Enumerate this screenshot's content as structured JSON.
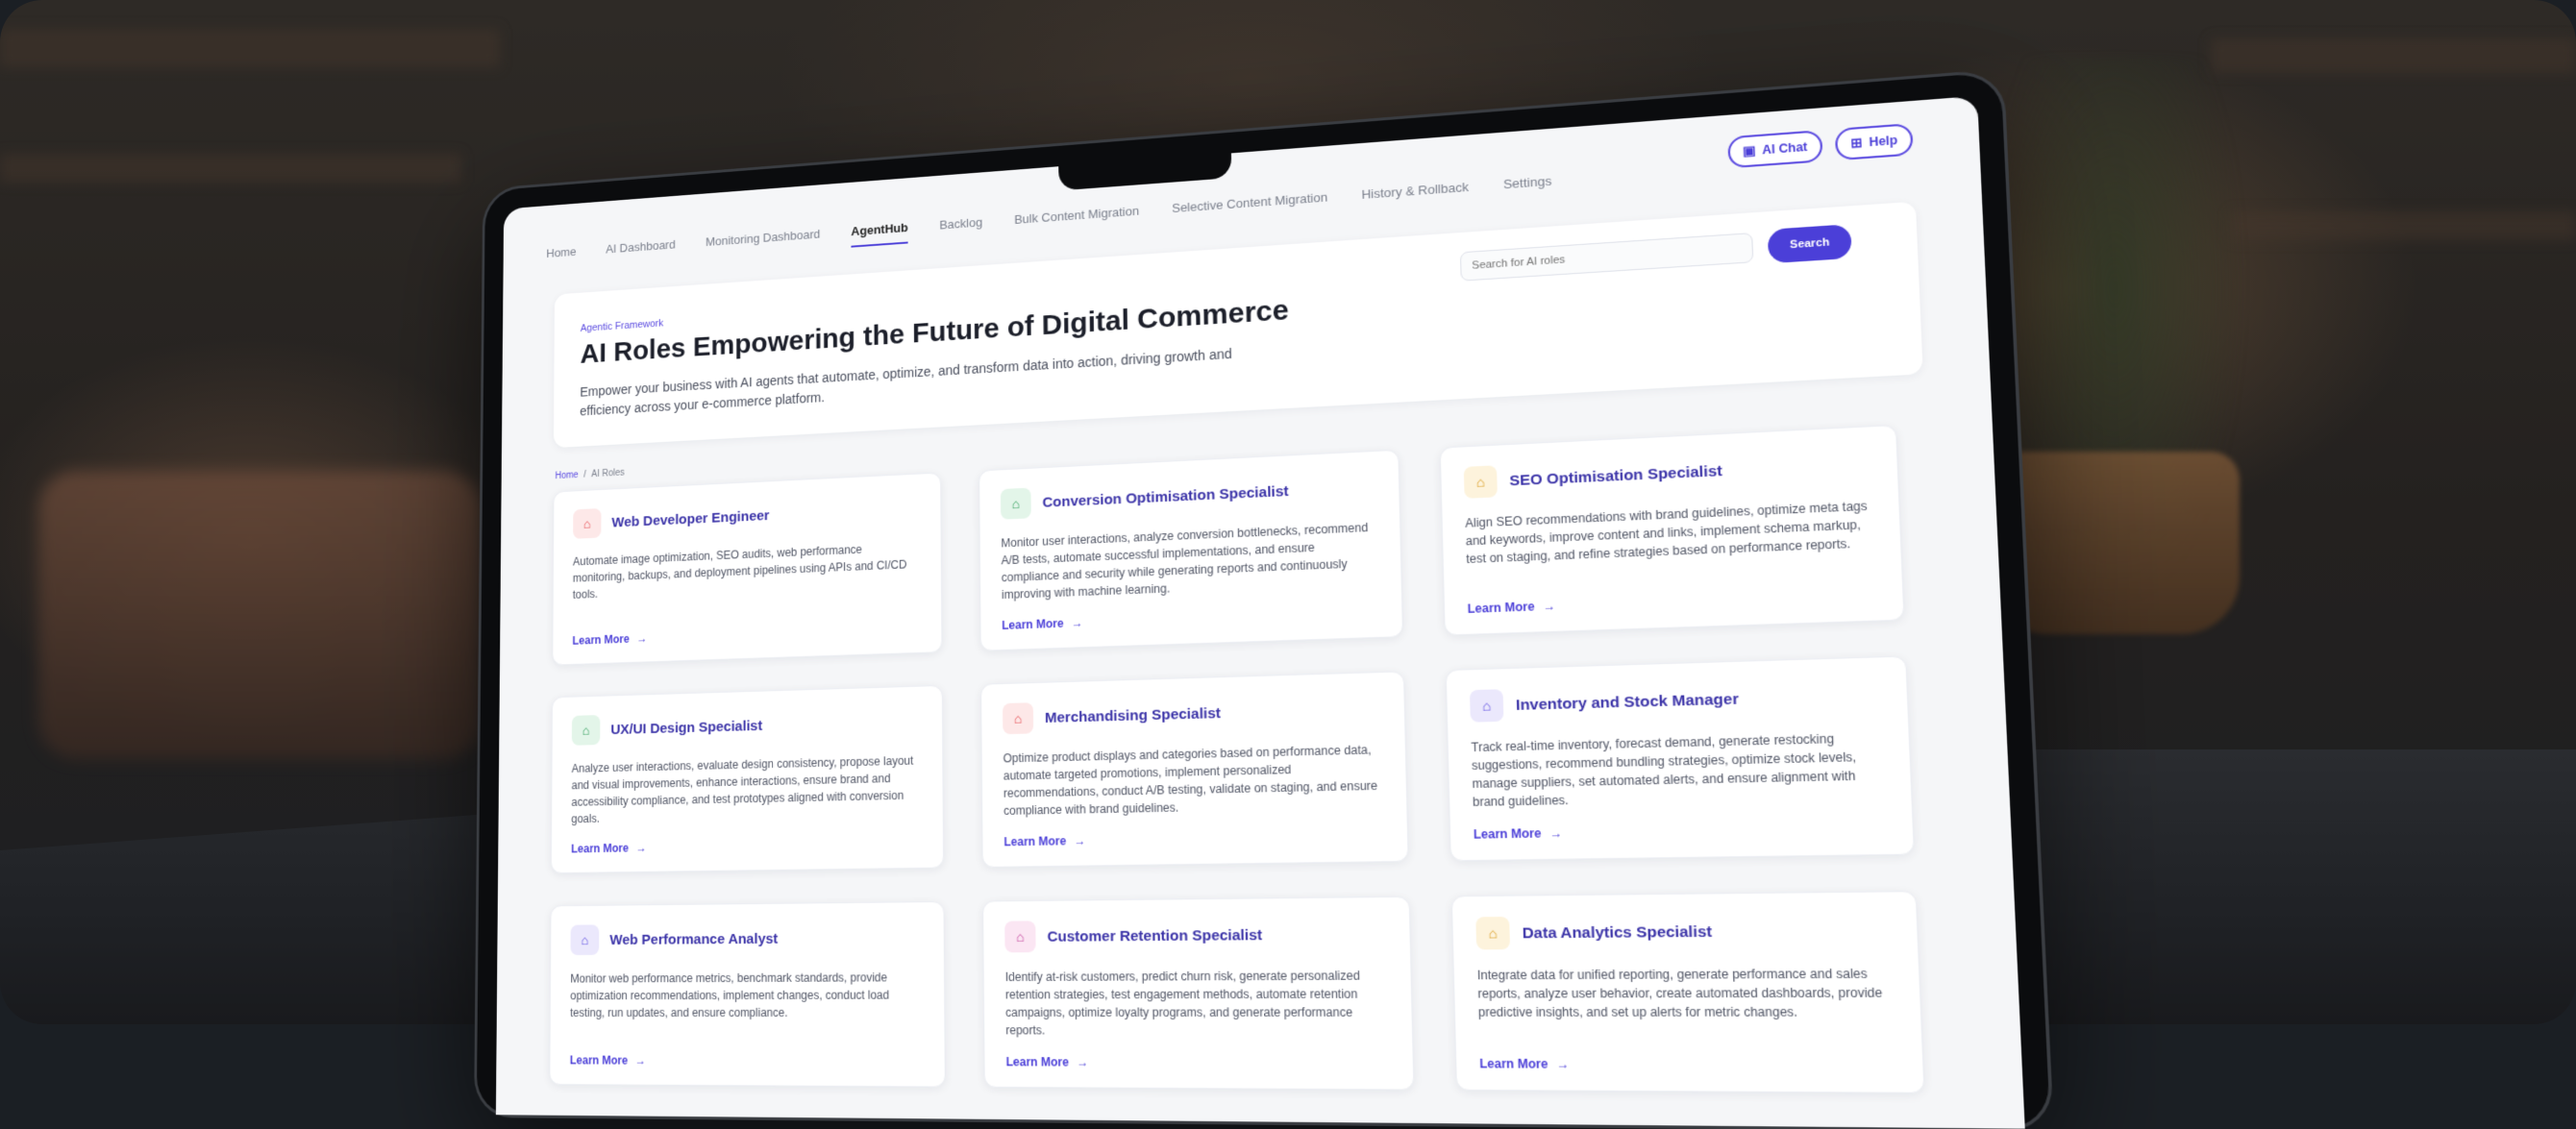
{
  "nav": {
    "tabs": [
      {
        "label": "Home"
      },
      {
        "label": "AI Dashboard"
      },
      {
        "label": "Monitoring Dashboard"
      },
      {
        "label": "AgentHub",
        "active": true
      },
      {
        "label": "Backlog"
      },
      {
        "label": "Bulk Content Migration"
      },
      {
        "label": "Selective Content Migration"
      },
      {
        "label": "History & Rollback"
      },
      {
        "label": "Settings"
      }
    ],
    "ai_chat_label": "AI Chat",
    "help_label": "Help"
  },
  "hero": {
    "eyebrow": "Agentic Framework",
    "title": "AI Roles Empowering the Future of Digital Commerce",
    "subtitle": "Empower your business with AI agents that automate, optimize, and transform data into action, driving growth and efficiency across your e-commerce platform."
  },
  "search": {
    "placeholder": "Search for AI roles",
    "button_label": "Search"
  },
  "breadcrumb": {
    "home": "Home",
    "separator": "/",
    "current": "AI Roles"
  },
  "cards": [
    {
      "title": "Web Developer Engineer",
      "icon": "robot-icon",
      "accent": "#e5484d",
      "accent_bg": "#fde8e8",
      "description": "Automate image optimization, SEO audits, web performance monitoring, backups, and deployment pipelines using APIs and CI/CD tools.",
      "link": "Learn More"
    },
    {
      "title": "Conversion Optimisation Specialist",
      "icon": "robot-icon",
      "accent": "#2f9e5a",
      "accent_bg": "#e3f5e9",
      "description": "Monitor user interactions, analyze conversion bottlenecks, recommend A/B tests, automate successful implementations, and ensure compliance and security while generating reports and continuously improving with machine learning.",
      "link": "Learn More"
    },
    {
      "title": "SEO Optimisation Specialist",
      "icon": "robot-icon",
      "accent": "#d99a1e",
      "accent_bg": "#fdf3dc",
      "description": "Align SEO recommendations with brand guidelines, optimize meta tags and keywords, improve content and links, implement schema markup, test on staging, and refine strategies based on performance reports.",
      "link": "Learn More"
    },
    {
      "title": "UX/UI Design Specialist",
      "icon": "robot-icon",
      "accent": "#2f9e5a",
      "accent_bg": "#e3f5e9",
      "description": "Analyze user interactions, evaluate design consistency, propose layout and visual improvements, enhance interactions, ensure brand and accessibility compliance, and test prototypes aligned with conversion goals.",
      "link": "Learn More"
    },
    {
      "title": "Merchandising Specialist",
      "icon": "robot-icon",
      "accent": "#e5484d",
      "accent_bg": "#fde8e8",
      "description": "Optimize product displays and categories based on performance data, automate targeted promotions, implement personalized recommendations, conduct A/B testing, validate on staging, and ensure compliance with brand guidelines.",
      "link": "Learn More"
    },
    {
      "title": "Inventory and Stock Manager",
      "icon": "robot-icon",
      "accent": "#5b4be0",
      "accent_bg": "#ebe8fc",
      "description": "Track real-time inventory, forecast demand, generate restocking suggestions, recommend bundling strategies, optimize stock levels, manage suppliers, set automated alerts, and ensure alignment with brand guidelines.",
      "link": "Learn More"
    },
    {
      "title": "Web Performance Analyst",
      "icon": "robot-icon",
      "accent": "#5b4be0",
      "accent_bg": "#ebe8fc",
      "description": "Monitor web performance metrics, benchmark standards, provide optimization recommendations, implement changes, conduct load testing, run updates, and ensure compliance.",
      "link": "Learn More"
    },
    {
      "title": "Customer Retention Specialist",
      "icon": "robot-icon",
      "accent": "#c2409a",
      "accent_bg": "#fbe6f3",
      "description": "Identify at-risk customers, predict churn risk, generate personalized retention strategies, test engagement methods, automate retention campaigns, optimize loyalty programs, and generate performance reports.",
      "link": "Learn More"
    },
    {
      "title": "Data Analytics Specialist",
      "icon": "robot-icon",
      "accent": "#d99a1e",
      "accent_bg": "#fdf3dc",
      "description": "Integrate data for unified reporting, generate performance and sales reports, analyze user behavior, create automated dashboards, provide predictive insights, and set up alerts for metric changes.",
      "link": "Learn More"
    }
  ]
}
